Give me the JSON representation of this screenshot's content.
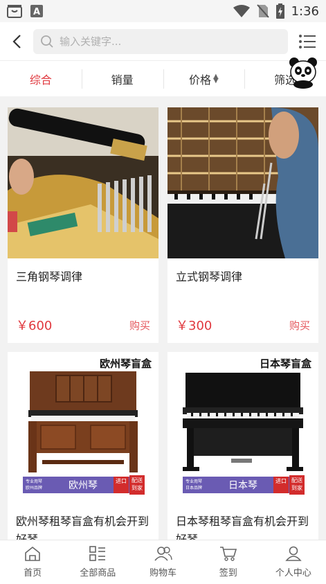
{
  "status_bar": {
    "time": "1:36",
    "left_icons": [
      "shopping-bag-icon",
      "text-a-icon"
    ],
    "right_icons": [
      "wifi-icon",
      "no-sim-icon",
      "battery-charging-icon"
    ]
  },
  "search": {
    "placeholder": "输入关键字..."
  },
  "sort_tabs": [
    {
      "label": "综合",
      "active": true
    },
    {
      "label": "销量",
      "active": false
    },
    {
      "label": "价格",
      "active": false,
      "sortable": true
    },
    {
      "label": "筛选",
      "active": false
    }
  ],
  "products": [
    {
      "title": "三角钢琴调律",
      "price": "￥600",
      "buy_label": "购买"
    },
    {
      "title": "立式钢琴调律",
      "price": "￥300",
      "buy_label": "购买"
    },
    {
      "title": "欧州琴租琴盲盒有机会开到好琴",
      "badge": "欧州琴盲盒",
      "tag_small": [
        "专业用琴",
        "欧州品牌"
      ],
      "tag_big": "欧州琴",
      "tag_red1": "进口",
      "tag_red2": "配送到家"
    },
    {
      "title": "日本琴租琴盲盒有机会开到好琴",
      "badge": "日本琴盲盒",
      "tag_small": [
        "专业用琴",
        "日本品牌"
      ],
      "tag_big": "日本琴",
      "tag_red1": "进口",
      "tag_red2": "配送到家"
    }
  ],
  "tabs": [
    {
      "label": "首页",
      "icon": "home-icon"
    },
    {
      "label": "全部商品",
      "icon": "grid-list-icon"
    },
    {
      "label": "购物车",
      "icon": "users-icon"
    },
    {
      "label": "签到",
      "icon": "cart-icon"
    },
    {
      "label": "个人中心",
      "icon": "person-icon"
    }
  ],
  "colors": {
    "accent": "#e0383e",
    "background": "#f2f2f2"
  }
}
